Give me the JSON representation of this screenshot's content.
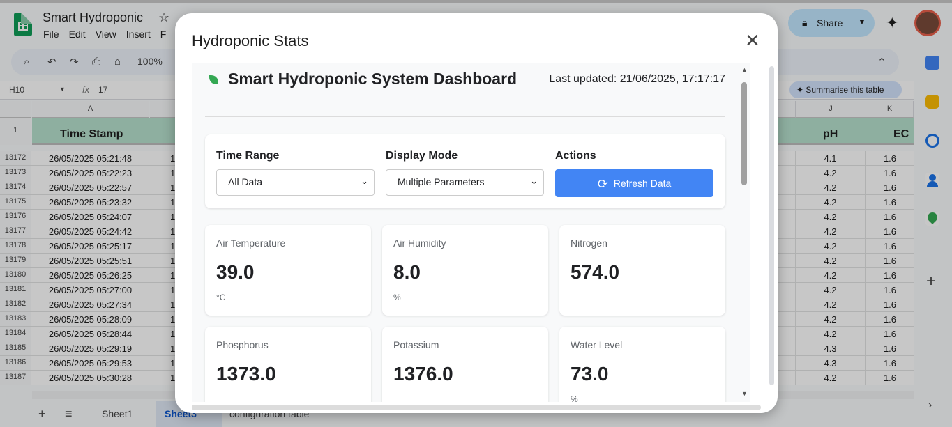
{
  "sheets": {
    "title": "Smart Hydroponic",
    "menu": [
      "File",
      "Edit",
      "View",
      "Insert",
      "F"
    ],
    "zoom": "100%",
    "name_box": "H10",
    "formula_value": "17",
    "summarise_label": "Summarise this table",
    "share_label": "Share",
    "columns": {
      "a": "A",
      "j": "J",
      "k": "K"
    },
    "header_row_number": "1",
    "headers": {
      "time": "Time Stamp",
      "ph": "pH",
      "ec": "EC"
    },
    "rows": [
      {
        "n": "13172",
        "ts": "26/05/2025 05:21:48",
        "c": "1",
        "ph": "4.1",
        "ec": "1.6"
      },
      {
        "n": "13173",
        "ts": "26/05/2025 05:22:23",
        "c": "1",
        "ph": "4.2",
        "ec": "1.6"
      },
      {
        "n": "13174",
        "ts": "26/05/2025 05:22:57",
        "c": "1",
        "ph": "4.2",
        "ec": "1.6"
      },
      {
        "n": "13175",
        "ts": "26/05/2025 05:23:32",
        "c": "1",
        "ph": "4.2",
        "ec": "1.6"
      },
      {
        "n": "13176",
        "ts": "26/05/2025 05:24:07",
        "c": "1",
        "ph": "4.2",
        "ec": "1.6"
      },
      {
        "n": "13177",
        "ts": "26/05/2025 05:24:42",
        "c": "1",
        "ph": "4.2",
        "ec": "1.6"
      },
      {
        "n": "13178",
        "ts": "26/05/2025 05:25:17",
        "c": "1",
        "ph": "4.2",
        "ec": "1.6"
      },
      {
        "n": "13179",
        "ts": "26/05/2025 05:25:51",
        "c": "1",
        "ph": "4.2",
        "ec": "1.6"
      },
      {
        "n": "13180",
        "ts": "26/05/2025 05:26:25",
        "c": "1",
        "ph": "4.2",
        "ec": "1.6"
      },
      {
        "n": "13181",
        "ts": "26/05/2025 05:27:00",
        "c": "1",
        "ph": "4.2",
        "ec": "1.6"
      },
      {
        "n": "13182",
        "ts": "26/05/2025 05:27:34",
        "c": "1",
        "ph": "4.2",
        "ec": "1.6"
      },
      {
        "n": "13183",
        "ts": "26/05/2025 05:28:09",
        "c": "1",
        "ph": "4.2",
        "ec": "1.6"
      },
      {
        "n": "13184",
        "ts": "26/05/2025 05:28:44",
        "c": "1",
        "ph": "4.2",
        "ec": "1.6"
      },
      {
        "n": "13185",
        "ts": "26/05/2025 05:29:19",
        "c": "1",
        "ph": "4.3",
        "ec": "1.6"
      },
      {
        "n": "13186",
        "ts": "26/05/2025 05:29:53",
        "c": "1",
        "ph": "4.3",
        "ec": "1.6"
      },
      {
        "n": "13187",
        "ts": "26/05/2025 05:30:28",
        "c": "1",
        "ph": "4.2",
        "ec": "1.6"
      }
    ],
    "tabs": [
      "Sheet1",
      "Sheet3",
      "configuration table"
    ]
  },
  "dialog": {
    "title": "Hydroponic Stats",
    "dashboard_title": "Smart Hydroponic System Dashboard",
    "last_updated": "Last updated: 21/06/2025, 17:17:17",
    "controls": {
      "time_range_label": "Time Range",
      "time_range_value": "All Data",
      "display_mode_label": "Display Mode",
      "display_mode_value": "Multiple Parameters",
      "actions_label": "Actions",
      "refresh_label": "Refresh Data"
    },
    "cards": [
      {
        "label": "Air Temperature",
        "value": "39.0",
        "unit": "°C"
      },
      {
        "label": "Air Humidity",
        "value": "8.0",
        "unit": "%"
      },
      {
        "label": "Nitrogen",
        "value": "574.0",
        "unit": ""
      },
      {
        "label": "Phosphorus",
        "value": "1373.0",
        "unit": ""
      },
      {
        "label": "Potassium",
        "value": "1376.0",
        "unit": ""
      },
      {
        "label": "Water Level",
        "value": "73.0",
        "unit": "%"
      }
    ]
  },
  "colors": {
    "accent": "#4285f4",
    "header_green": "#b7e1cd",
    "leaf": "#34a853"
  }
}
